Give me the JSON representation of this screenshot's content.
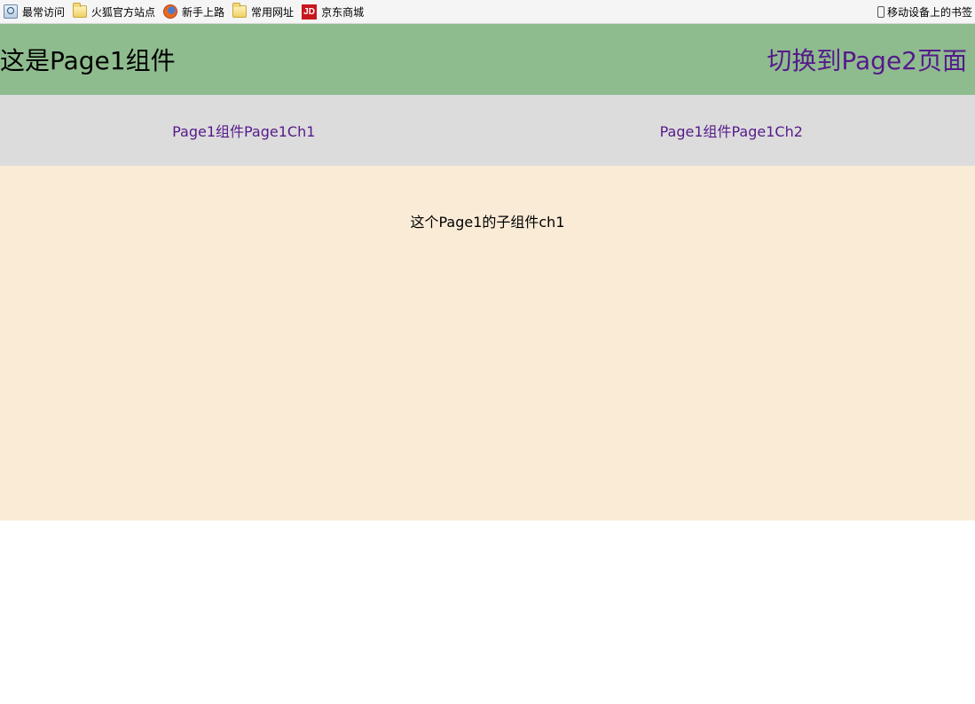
{
  "bookmarks": {
    "items": [
      {
        "label": "最常访问",
        "icon": "most-visited-icon"
      },
      {
        "label": "火狐官方站点",
        "icon": "folder-icon"
      },
      {
        "label": "新手上路",
        "icon": "firefox-icon"
      },
      {
        "label": "常用网址",
        "icon": "folder-icon"
      },
      {
        "label": "京东商城",
        "icon": "jd-icon",
        "icon_text": "JD"
      }
    ],
    "mobile": {
      "label": "移动设备上的书签",
      "icon": "phone-icon"
    }
  },
  "header": {
    "title": "这是Page1组件",
    "switch_link": "切换到Page2页面",
    "background": "#8fbc8f"
  },
  "sub_nav": {
    "links": [
      "Page1组件Page1Ch1",
      "Page1组件Page1Ch2"
    ],
    "background": "#dcdcdc"
  },
  "content": {
    "text": "这个Page1的子组件ch1",
    "background": "#faebd7"
  },
  "colors": {
    "link": "#551a8b"
  }
}
